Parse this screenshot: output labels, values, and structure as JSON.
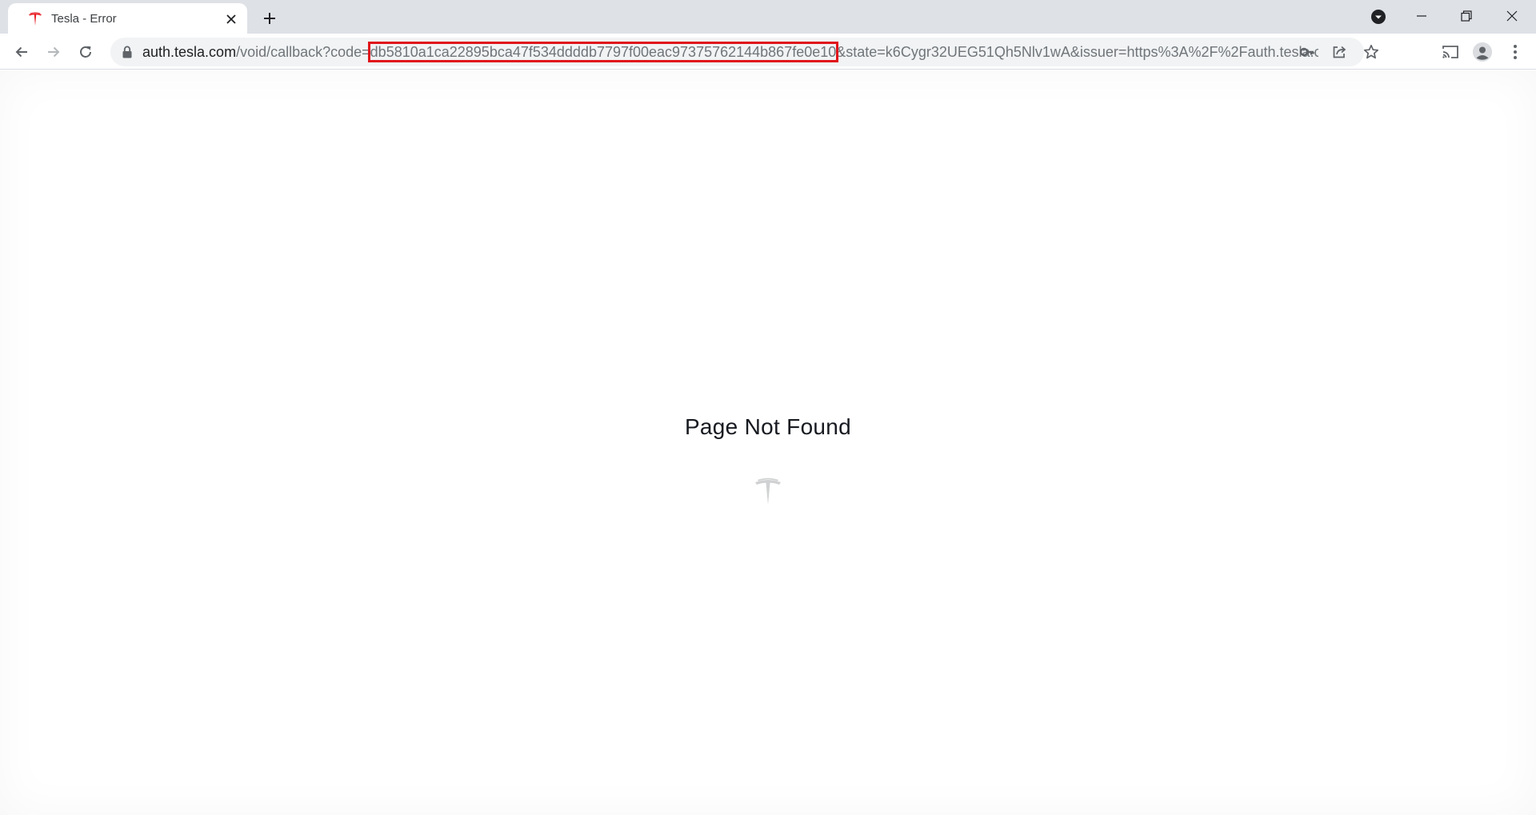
{
  "browser": {
    "tab": {
      "title": "Tesla - Error",
      "favicon": "tesla-logo-icon",
      "favicon_color": "#e82127"
    },
    "address_bar": {
      "host": "auth.tesla.com",
      "path_before_code": "/void/callback?code=",
      "code_value": "db5810a1ca22895bca47f534ddddb7797f00eac97375762144b867fe0e10",
      "after_code": "&state=k6Cygr32UEG51Qh5Nlv1wA&issuer=https%3A%2F%2Fauth.tesla.com%2F...",
      "highlight_color": "#e0141b"
    },
    "icons": {
      "back": "arrow-left-icon",
      "forward": "arrow-right-icon",
      "reload": "reload-icon",
      "lock": "lock-icon",
      "key": "key-icon",
      "share": "share-icon",
      "bookmark": "star-icon",
      "cast": "cast-icon",
      "profile": "person-icon",
      "menu": "three-dot-menu-icon"
    }
  },
  "page": {
    "title": "Page Not Found",
    "logo": "tesla-logo-icon",
    "logo_color": "#d0d1d2"
  }
}
